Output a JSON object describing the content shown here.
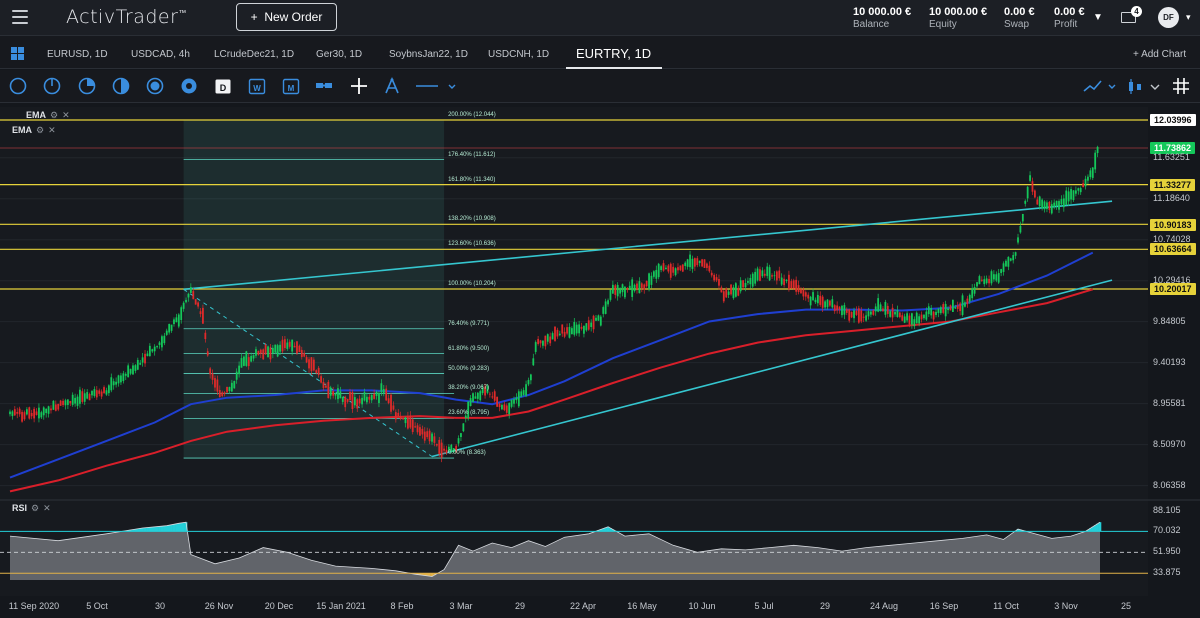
{
  "header": {
    "logo": "ActivTrader",
    "new_order_label": "New Order",
    "account": [
      {
        "value": "10 000.00 €",
        "label": "Balance"
      },
      {
        "value": "10 000.00 €",
        "label": "Equity"
      },
      {
        "value": "0.00 €",
        "label": "Swap"
      },
      {
        "value": "0.00 €",
        "label": "Profit"
      }
    ],
    "mail_count": "4",
    "avatar_initials": "DF"
  },
  "tabs": [
    "EURUSD, 1D",
    "USDCAD, 4h",
    "LCrudeDec21, 1D",
    "Ger30, 1D",
    "SoybnsJan22, 1D",
    "USDCNH, 1D",
    "EURTRY, 1D"
  ],
  "active_tab": "EURTRY, 1D",
  "add_chart_label": "+ Add Chart",
  "toolbar_icons": [
    "circle-icon",
    "circle-segment-icon",
    "pie-icon",
    "half-circle-icon",
    "ring-icon",
    "dot-circle-icon",
    "calendar-d-icon",
    "calendar-w-icon",
    "calendar-m-icon",
    "bar-link-icon",
    "crosshair-icon",
    "draw-icon",
    "line-style-icon",
    "chart-type-icon",
    "candle-settings-icon",
    "more-icon",
    "grid-icon"
  ],
  "indicators": {
    "ema1": "EMA",
    "ema2": "EMA",
    "rsi": "RSI"
  },
  "colors": {
    "bull": "#14c85a",
    "bear": "#e02a2a",
    "ema_fast": "#1f3fd1",
    "ema_slow": "#d91f2a",
    "trend": "#35c6cf",
    "fib": "#e6d23a",
    "fib_inner": "#5bd6c1",
    "rsi_high": "#24d0d9",
    "rsi_low": "#e2b248",
    "current_price": "#14c85a"
  },
  "chart_data": {
    "type": "candlestick",
    "symbol": "EURTRY",
    "timeframe": "1D",
    "x_tick_labels": [
      "11 Sep 2020",
      "5 Oct",
      "30",
      "26 Nov",
      "20 Dec",
      "15 Jan 2021",
      "8 Feb",
      "3 Mar",
      "29",
      "22 Apr",
      "16 May",
      "10 Jun",
      "5 Jul",
      "29",
      "24 Aug",
      "16 Sep",
      "11 Oct",
      "3 Nov",
      "25"
    ],
    "y_tick_labels": [
      "11.63251",
      "11.18640",
      "10.74028",
      "10.29416",
      "9.84805",
      "9.40193",
      "8.95581",
      "8.50970",
      "8.06358"
    ],
    "y_ticks": [
      11.63251,
      11.1864,
      10.74028,
      10.29416,
      9.84805,
      9.40193,
      8.95581,
      8.5097,
      8.06358
    ],
    "ylim": [
      7.95,
      12.12
    ],
    "current_price": 11.73862,
    "price_badges": [
      "12.03996",
      "11.73862",
      "11.33277",
      "10.90183",
      "10.63664",
      "10.20017"
    ],
    "fibonacci": {
      "levels": [
        "200.00% (12.044)",
        "176.40% (11.612)",
        "161.80% (11.340)",
        "138.20% (10.908)",
        "123.60% (10.636)",
        "100.00% (10.204)",
        "76.40% (9.771)",
        "61.80% (9.500)",
        "50.00% (9.283)",
        "38.20% (9.067)",
        "23.60% (8.795)",
        "0.00% (8.363)"
      ],
      "values": [
        12.044,
        11.612,
        11.34,
        10.908,
        10.636,
        10.204,
        9.771,
        9.5,
        9.283,
        9.067,
        8.795,
        8.363
      ],
      "extended": [
        12.044,
        11.34,
        10.908,
        10.636,
        10.204
      ]
    },
    "price_path": [
      [
        0,
        8.85
      ],
      [
        12,
        8.85
      ],
      [
        22,
        8.95
      ],
      [
        40,
        9.1
      ],
      [
        52,
        9.35
      ],
      [
        62,
        9.6
      ],
      [
        70,
        9.9
      ],
      [
        75,
        10.2
      ],
      [
        80,
        9.9
      ],
      [
        83,
        9.3
      ],
      [
        88,
        9.05
      ],
      [
        93,
        9.15
      ],
      [
        96,
        9.4
      ],
      [
        102,
        9.5
      ],
      [
        108,
        9.5
      ],
      [
        115,
        9.6
      ],
      [
        120,
        9.55
      ],
      [
        126,
        9.35
      ],
      [
        132,
        9.1
      ],
      [
        140,
        9.0
      ],
      [
        150,
        9.0
      ],
      [
        155,
        9.1
      ],
      [
        160,
        8.85
      ],
      [
        168,
        8.7
      ],
      [
        175,
        8.55
      ],
      [
        180,
        8.45
      ],
      [
        185,
        8.45
      ],
      [
        190,
        8.9
      ],
      [
        194,
        9.05
      ],
      [
        198,
        9.1
      ],
      [
        202,
        8.95
      ],
      [
        206,
        8.9
      ],
      [
        210,
        9.0
      ],
      [
        214,
        9.1
      ],
      [
        216,
        9.25
      ],
      [
        218,
        9.6
      ],
      [
        222,
        9.65
      ],
      [
        226,
        9.7
      ],
      [
        232,
        9.75
      ],
      [
        240,
        9.8
      ],
      [
        245,
        9.9
      ],
      [
        250,
        10.2
      ],
      [
        258,
        10.2
      ],
      [
        264,
        10.25
      ],
      [
        270,
        10.45
      ],
      [
        276,
        10.4
      ],
      [
        282,
        10.5
      ],
      [
        287,
        10.5
      ],
      [
        292,
        10.35
      ],
      [
        296,
        10.15
      ],
      [
        302,
        10.2
      ],
      [
        310,
        10.35
      ],
      [
        318,
        10.35
      ],
      [
        326,
        10.25
      ],
      [
        332,
        10.1
      ],
      [
        338,
        10.05
      ],
      [
        342,
        10.0
      ],
      [
        348,
        9.95
      ],
      [
        354,
        9.9
      ],
      [
        360,
        10.0
      ],
      [
        366,
        9.95
      ],
      [
        370,
        9.9
      ],
      [
        374,
        9.85
      ],
      [
        378,
        9.9
      ],
      [
        382,
        9.95
      ],
      [
        386,
        9.95
      ],
      [
        390,
        10.0
      ],
      [
        394,
        10.0
      ],
      [
        398,
        10.1
      ],
      [
        402,
        10.3
      ],
      [
        406,
        10.3
      ],
      [
        410,
        10.35
      ],
      [
        414,
        10.5
      ],
      [
        417,
        10.6
      ],
      [
        420,
        11.0
      ],
      [
        423,
        11.4
      ],
      [
        426,
        11.15
      ],
      [
        432,
        11.1
      ],
      [
        438,
        11.2
      ],
      [
        442,
        11.25
      ],
      [
        446,
        11.35
      ],
      [
        449,
        11.5
      ],
      [
        451,
        11.7
      ],
      [
        452,
        11.74
      ]
    ],
    "ema_fast": [
      [
        0,
        8.15
      ],
      [
        20,
        8.35
      ],
      [
        40,
        8.55
      ],
      [
        60,
        8.75
      ],
      [
        75,
        8.95
      ],
      [
        90,
        9.02
      ],
      [
        110,
        9.05
      ],
      [
        130,
        9.1
      ],
      [
        150,
        9.1
      ],
      [
        170,
        9.07
      ],
      [
        185,
        9.0
      ],
      [
        200,
        8.95
      ],
      [
        215,
        9.05
      ],
      [
        230,
        9.2
      ],
      [
        250,
        9.45
      ],
      [
        270,
        9.65
      ],
      [
        290,
        9.85
      ],
      [
        310,
        9.93
      ],
      [
        330,
        9.98
      ],
      [
        350,
        9.98
      ],
      [
        370,
        9.97
      ],
      [
        390,
        10.0
      ],
      [
        410,
        10.15
      ],
      [
        430,
        10.35
      ],
      [
        449,
        10.6
      ]
    ],
    "ema_slow": [
      [
        0,
        8.0
      ],
      [
        20,
        8.12
      ],
      [
        40,
        8.28
      ],
      [
        60,
        8.42
      ],
      [
        75,
        8.55
      ],
      [
        90,
        8.65
      ],
      [
        110,
        8.72
      ],
      [
        130,
        8.77
      ],
      [
        150,
        8.8
      ],
      [
        170,
        8.82
      ],
      [
        185,
        8.8
      ],
      [
        200,
        8.8
      ],
      [
        215,
        8.87
      ],
      [
        230,
        9.0
      ],
      [
        250,
        9.18
      ],
      [
        270,
        9.35
      ],
      [
        290,
        9.5
      ],
      [
        310,
        9.62
      ],
      [
        330,
        9.7
      ],
      [
        350,
        9.75
      ],
      [
        370,
        9.8
      ],
      [
        390,
        9.85
      ],
      [
        410,
        9.95
      ],
      [
        430,
        10.05
      ],
      [
        449,
        10.2
      ]
    ],
    "trendlines": [
      {
        "from": [
          72,
          10.2
        ],
        "to": [
          457,
          11.16
        ]
      },
      {
        "from": [
          175,
          8.38
        ],
        "to": [
          457,
          10.3
        ]
      },
      {
        "from": [
          72,
          10.2
        ],
        "to": [
          175,
          8.38
        ],
        "dashed": true
      }
    ],
    "rsi": {
      "y_tick_labels": [
        "88.105",
        "70.032",
        "51.950",
        "33.875"
      ],
      "y_ticks": [
        88.105,
        70.032,
        51.95,
        33.875
      ],
      "ylim": [
        28,
        92
      ],
      "values": [
        [
          0,
          66
        ],
        [
          20,
          62
        ],
        [
          40,
          68
        ],
        [
          55,
          73
        ],
        [
          65,
          75
        ],
        [
          70,
          77
        ],
        [
          73,
          78
        ],
        [
          75,
          50
        ],
        [
          85,
          42
        ],
        [
          95,
          47
        ],
        [
          105,
          56
        ],
        [
          115,
          52
        ],
        [
          125,
          45
        ],
        [
          135,
          40
        ],
        [
          150,
          38
        ],
        [
          160,
          36
        ],
        [
          168,
          33
        ],
        [
          175,
          31
        ],
        [
          180,
          37
        ],
        [
          186,
          58
        ],
        [
          192,
          53
        ],
        [
          200,
          60
        ],
        [
          208,
          56
        ],
        [
          215,
          62
        ],
        [
          222,
          57
        ],
        [
          230,
          65
        ],
        [
          240,
          68
        ],
        [
          248,
          74
        ],
        [
          255,
          66
        ],
        [
          265,
          68
        ],
        [
          275,
          58
        ],
        [
          285,
          52
        ],
        [
          295,
          55
        ],
        [
          305,
          54
        ],
        [
          315,
          56
        ],
        [
          325,
          58
        ],
        [
          335,
          56
        ],
        [
          345,
          53
        ],
        [
          355,
          56
        ],
        [
          365,
          58
        ],
        [
          375,
          60
        ],
        [
          385,
          62
        ],
        [
          395,
          64
        ],
        [
          405,
          67
        ],
        [
          412,
          63
        ],
        [
          418,
          72
        ],
        [
          425,
          68
        ],
        [
          432,
          64
        ],
        [
          440,
          66
        ],
        [
          446,
          70
        ],
        [
          452,
          78
        ]
      ]
    }
  }
}
